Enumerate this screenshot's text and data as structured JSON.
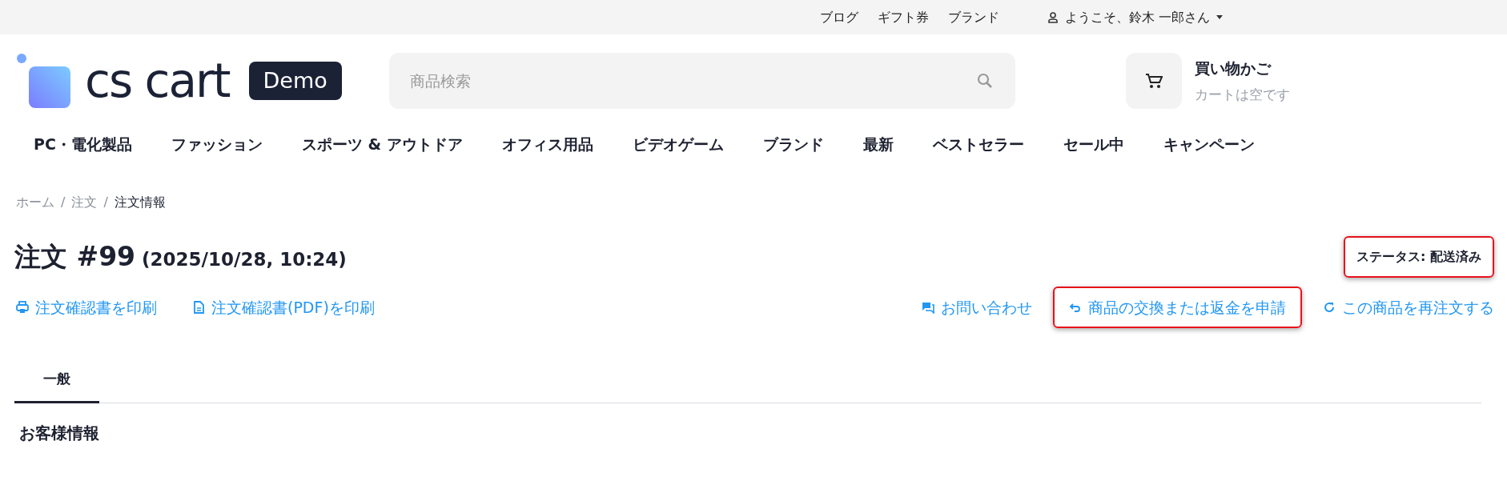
{
  "top_links": [
    "ブログ",
    "ギフト券",
    "ブランド"
  ],
  "user_menu": {
    "label": "ようこそ、鈴木 一郎さん"
  },
  "logo": {
    "text": "cs cart",
    "badge": "Demo"
  },
  "search": {
    "placeholder": "商品検索"
  },
  "cart": {
    "title": "買い物かご",
    "subtitle": "カートは空です"
  },
  "nav": [
    "PC・電化製品",
    "ファッション",
    "スポーツ & アウトドア",
    "オフィス用品",
    "ビデオゲーム",
    "ブランド",
    "最新",
    "ベストセラー",
    "セール中",
    "キャンペーン"
  ],
  "breadcrumb_separator": "/",
  "breadcrumbs": [
    {
      "label": "ホーム",
      "current": false
    },
    {
      "label": "注文",
      "current": false
    },
    {
      "label": "注文情報",
      "current": true
    }
  ],
  "order": {
    "title": "注文 #99",
    "date": "(2025/10/28, 10:24)",
    "status": {
      "label": "ステータス: 配送済み",
      "highlighted": true
    }
  },
  "actions_left": [
    {
      "kind": "print",
      "label": "注文確認書を印刷",
      "highlighted": false
    },
    {
      "kind": "pdf",
      "label": "注文確認書(PDF)を印刷",
      "highlighted": false
    }
  ],
  "actions_right": [
    {
      "kind": "message",
      "label": "お問い合わせ",
      "highlighted": false
    },
    {
      "kind": "return",
      "label": "商品の交換または返金を申請",
      "highlighted": true
    },
    {
      "kind": "reorder",
      "label": "この商品を再注文する",
      "highlighted": false
    }
  ],
  "tabs": [
    {
      "label": "一般",
      "selected": true
    }
  ],
  "section_title": "お客様情報"
}
